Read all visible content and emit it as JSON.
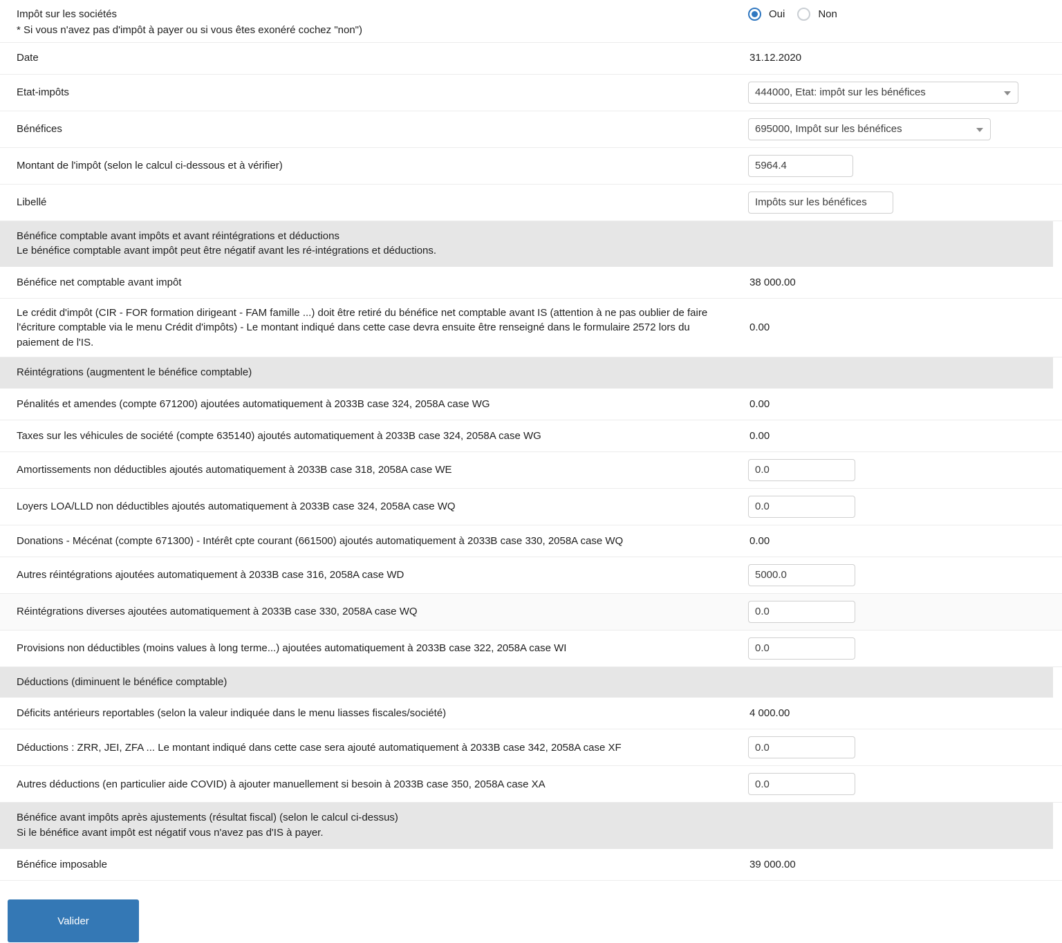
{
  "colors": {
    "accent": "#3478b5",
    "radio_selected": "#2f77c0",
    "section_bg": "#e6e6e6",
    "row_border": "#ececec",
    "input_border": "#cfcfcf"
  },
  "header": {
    "title": "Impôt sur les sociétés",
    "note": "* Si vous n'avez pas d'impôt à payer ou si vous êtes exonéré cochez \"non\")",
    "radio_yes": "Oui",
    "radio_no": "Non",
    "selected": "Oui"
  },
  "form": {
    "date_label": "Date",
    "date_value": "31.12.2020",
    "etat_impots_label": "Etat-impôts",
    "etat_impots_value": "444000, Etat: impôt sur les bénéfices",
    "benefices_label": "Bénéfices",
    "benefices_value": "695000, Impôt sur les bénéfices",
    "montant_label": "Montant de l'impôt (selon le calcul ci-dessous et à vérifier)",
    "montant_value": "5964.4",
    "libelle_label": "Libellé",
    "libelle_value": "Impôts sur les bénéfices"
  },
  "section_benefice": {
    "line1": "Bénéfice comptable avant impôts et avant réintégrations et déductions",
    "line2": "Le bénéfice comptable avant impôt peut être négatif avant les ré-intégrations et déductions."
  },
  "benefice_rows": [
    {
      "label": "Bénéfice net comptable avant impôt",
      "value": "38 000.00"
    },
    {
      "label_line1": "Le crédit d'impôt (CIR - FOR formation dirigeant - FAM famille ...) doit être retiré du bénéfice net comptable avant IS",
      "label_line2": "(attention à ne pas oublier de faire l'écriture comptable via le menu Crédit d'impôts) -",
      "label_line3": "Le montant indiqué dans cette case devra ensuite être renseigné dans le formulaire 2572 lors du paiement de l'IS.",
      "value": "0.00"
    }
  ],
  "section_reintegrations": {
    "line1": "Réintégrations (augmentent le bénéfice comptable)"
  },
  "reintegration_rows": [
    {
      "label": "Pénalités et amendes (compte 671200) ajoutées automatiquement à 2033B case 324, 2058A case WG",
      "value": "0.00",
      "type": "text"
    },
    {
      "label": "Taxes sur les véhicules de société (compte 635140) ajoutés automatiquement à 2033B case 324, 2058A case WG",
      "value": "0.00",
      "type": "text"
    },
    {
      "label": "Amortissements non déductibles ajoutés automatiquement à 2033B case 318, 2058A case WE",
      "value": "0.0",
      "type": "input"
    },
    {
      "label": "Loyers LOA/LLD non déductibles ajoutés automatiquement à 2033B case 324, 2058A case WQ",
      "value": "0.0",
      "type": "input"
    },
    {
      "label_line1": "Donations - Mécénat (compte 671300) - Intérêt cpte courant (661500) ajoutés automatiquement à 2033B case 330,",
      "label_line2": "2058A case WQ",
      "value": "0.00",
      "type": "text"
    },
    {
      "label": "Autres réintégrations ajoutées automatiquement à 2033B case 316, 2058A case WD",
      "value": "5000.0",
      "type": "input"
    },
    {
      "label": "Réintégrations diverses ajoutées automatiquement à 2033B case 330, 2058A case WQ",
      "value": "0.0",
      "type": "input"
    },
    {
      "label": "Provisions non déductibles (moins values à long terme...) ajoutées automatiquement à 2033B case 322, 2058A case WI",
      "value": "0.0",
      "type": "input"
    }
  ],
  "section_deductions": {
    "line1": "Déductions (diminuent le bénéfice comptable)"
  },
  "deduction_rows": [
    {
      "label_line1": "Déficits antérieurs reportables",
      "label_line2": "(selon la valeur indiquée dans le menu liasses fiscales/société)",
      "value": "4 000.00",
      "type": "text"
    },
    {
      "label_line1": "Déductions : ZRR, JEI, ZFA ...",
      "label_line2": "Le montant indiqué dans cette case sera ajouté automatiquement à 2033B case 342, 2058A case XF",
      "value": "0.0",
      "type": "input"
    },
    {
      "label": "Autres déductions (en particulier aide COVID) à ajouter manuellement si besoin à 2033B case 350, 2058A case XA",
      "value": "0.0",
      "type": "input"
    }
  ],
  "section_resultat": {
    "line1": "Bénéfice avant impôts après ajustements (résultat fiscal) (selon le calcul ci-dessus)",
    "line2": "Si le bénéfice avant impôt est négatif vous n'avez pas d'IS à payer."
  },
  "resultat_row": {
    "label": "Bénéfice imposable",
    "value": "39 000.00"
  },
  "footer": {
    "submit_label": "Valider"
  }
}
